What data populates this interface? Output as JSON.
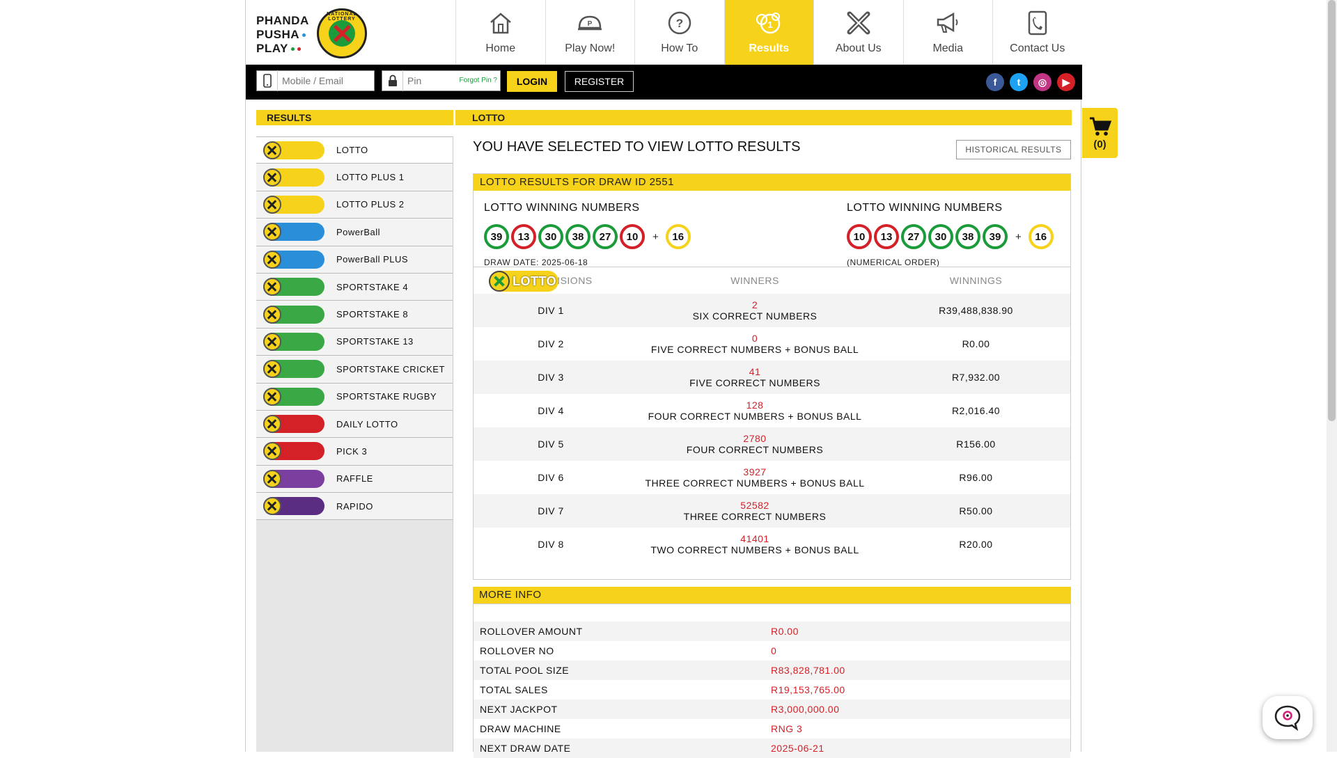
{
  "logo": {
    "line1": "PHANDA",
    "line2": "PUSHA",
    "line3": "PLAY",
    "badge_text": "NATIONAL LOTTERY"
  },
  "nav": [
    {
      "label": "Home",
      "icon": "home-icon"
    },
    {
      "label": "Play Now!",
      "icon": "play-icon"
    },
    {
      "label": "How To",
      "icon": "question-icon"
    },
    {
      "label": "Results",
      "icon": "results-icon",
      "active": true
    },
    {
      "label": "About Us",
      "icon": "about-icon"
    },
    {
      "label": "Media",
      "icon": "megaphone-icon"
    },
    {
      "label": "Contact Us",
      "icon": "phone-icon"
    }
  ],
  "login": {
    "mobile_placeholder": "Mobile / Email",
    "pin_placeholder": "Pin",
    "forgot": "Forgot Pin ?",
    "login_label": "LOGIN",
    "register_label": "REGISTER"
  },
  "social": [
    {
      "name": "facebook-icon",
      "glyph": "f",
      "color": "#3b5998"
    },
    {
      "name": "twitter-icon",
      "glyph": "t",
      "color": "#1da1f2"
    },
    {
      "name": "instagram-icon",
      "glyph": "◎",
      "color": "#c13584"
    },
    {
      "name": "youtube-icon",
      "glyph": "▶",
      "color": "#d42027"
    }
  ],
  "cart": {
    "count": "(0)"
  },
  "sidebar": {
    "heading": "RESULTS",
    "items": [
      {
        "label": "LOTTO",
        "badge": "LOTTO",
        "color": "#f7d21a"
      },
      {
        "label": "LOTTO PLUS 1",
        "badge": "LOTTO PLUS 1",
        "color": "#f7d21a"
      },
      {
        "label": "LOTTO PLUS 2",
        "badge": "LOTTO PLUS 2",
        "color": "#f7d21a"
      },
      {
        "label": "PowerBall",
        "badge": "PowerBall",
        "color": "#2a8fd8"
      },
      {
        "label": "PowerBall PLUS",
        "badge": "PowerBall PLUS",
        "color": "#2a8fd8"
      },
      {
        "label": "SPORTSTAKE 4",
        "badge": "SPORTSTAKE 4",
        "color": "#3aa845"
      },
      {
        "label": "SPORTSTAKE 8",
        "badge": "SPORTSTAKE 8",
        "color": "#3aa845"
      },
      {
        "label": "SPORTSTAKE 13",
        "badge": "SPORTSTAKE 13",
        "color": "#3aa845"
      },
      {
        "label": "SPORTSTAKE CRICKET",
        "badge": "SPORTSTAKE CRICKET",
        "color": "#3aa845"
      },
      {
        "label": "SPORTSTAKE RUGBY",
        "badge": "SPORTSTAKE RUGBY",
        "color": "#3aa845"
      },
      {
        "label": "DAILY LOTTO",
        "badge": "DAILY LOTTO",
        "color": "#d42027"
      },
      {
        "label": "PICK 3",
        "badge": "PICK 3",
        "color": "#d42027"
      },
      {
        "label": "RAFFLE",
        "badge": "RAFFLE",
        "color": "#7b3fa0"
      },
      {
        "label": "RAPIDO",
        "badge": "RAPIDO",
        "color": "#5a2d82"
      }
    ]
  },
  "main": {
    "heading": "LOTTO",
    "title": "YOU HAVE SELECTED TO VIEW LOTTO RESULTS",
    "historical_button": "HISTORICAL RESULTS",
    "draw_heading": "LOTTO RESULTS FOR DRAW ID 2551",
    "winning_left": {
      "title": "LOTTO WINNING NUMBERS",
      "balls": [
        {
          "n": "39",
          "c": "green"
        },
        {
          "n": "13",
          "c": "red"
        },
        {
          "n": "30",
          "c": "green"
        },
        {
          "n": "38",
          "c": "green"
        },
        {
          "n": "27",
          "c": "green"
        },
        {
          "n": "10",
          "c": "red"
        }
      ],
      "bonus": "16",
      "sub": "DRAW DATE: 2025-06-18"
    },
    "winning_right": {
      "title": "LOTTO WINNING NUMBERS",
      "balls": [
        {
          "n": "10",
          "c": "red"
        },
        {
          "n": "13",
          "c": "red"
        },
        {
          "n": "27",
          "c": "green"
        },
        {
          "n": "30",
          "c": "green"
        },
        {
          "n": "38",
          "c": "green"
        },
        {
          "n": "39",
          "c": "green"
        }
      ],
      "bonus": "16",
      "sub": "(NUMERICAL ORDER)"
    },
    "plus_sign": "+",
    "table": {
      "logo_text": "LOTTO",
      "headers": [
        "DIVISIONS",
        "WINNERS",
        "WINNINGS"
      ],
      "rows": [
        {
          "div": "DIV 1",
          "count": "2",
          "desc": "SIX CORRECT NUMBERS",
          "amount": "R39,488,838.90"
        },
        {
          "div": "DIV 2",
          "count": "0",
          "desc": "FIVE CORRECT NUMBERS + BONUS BALL",
          "amount": "R0.00"
        },
        {
          "div": "DIV 3",
          "count": "41",
          "desc": "FIVE CORRECT NUMBERS",
          "amount": "R7,932.00"
        },
        {
          "div": "DIV 4",
          "count": "128",
          "desc": "FOUR CORRECT NUMBERS + BONUS BALL",
          "amount": "R2,016.40"
        },
        {
          "div": "DIV 5",
          "count": "2780",
          "desc": "FOUR CORRECT NUMBERS",
          "amount": "R156.00"
        },
        {
          "div": "DIV 6",
          "count": "3927",
          "desc": "THREE CORRECT NUMBERS + BONUS BALL",
          "amount": "R96.00"
        },
        {
          "div": "DIV 7",
          "count": "52582",
          "desc": "THREE CORRECT NUMBERS",
          "amount": "R50.00"
        },
        {
          "div": "DIV 8",
          "count": "41401",
          "desc": "TWO CORRECT NUMBERS + BONUS BALL",
          "amount": "R20.00"
        }
      ]
    },
    "more_info": {
      "heading": "MORE INFO",
      "rows": [
        {
          "k": "ROLLOVER AMOUNT",
          "v": "R0.00"
        },
        {
          "k": "ROLLOVER NO",
          "v": "0"
        },
        {
          "k": "TOTAL POOL SIZE",
          "v": "R83,828,781.00"
        },
        {
          "k": "TOTAL SALES",
          "v": "R19,153,765.00"
        },
        {
          "k": "NEXT JACKPOT",
          "v": "R3,000,000.00"
        },
        {
          "k": "DRAW MACHINE",
          "v": "RNG 3"
        },
        {
          "k": "NEXT DRAW DATE",
          "v": "2025-06-21"
        }
      ]
    }
  }
}
